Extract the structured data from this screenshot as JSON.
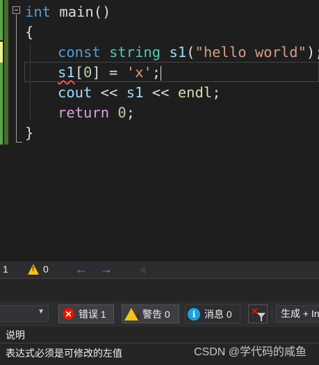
{
  "editor": {
    "lines": [
      {
        "t1": "int",
        "t2": " main()"
      },
      {
        "t1": "{"
      },
      {
        "t1": "const",
        "t2": "string",
        "t3": "s1",
        "t4": "(",
        "t5": "\"hello world\"",
        "t6": ");"
      },
      {
        "t1": "s1",
        "t2": "[",
        "t3": "0",
        "t4": "] = ",
        "t5": "'x'",
        "t6": ";"
      },
      {
        "t1": "cout",
        "t2": " << ",
        "t3": "s1",
        "t4": " << ",
        "t5": "endl",
        "t6": ";"
      },
      {
        "t1": "return",
        "t2": " ",
        "t3": "0",
        "t4": ";"
      },
      {
        "t1": "}"
      }
    ]
  },
  "nav": {
    "line_number": "1",
    "warning_count": "0"
  },
  "toolbar": {
    "errors_label": "错误 1",
    "warnings_label": "警告 0",
    "messages_label": "消息 0",
    "build_label": "生成 + In"
  },
  "error_list": {
    "column_header": "说明",
    "rows": [
      {
        "description": "表达式必须是可修改的左值"
      }
    ]
  },
  "watermark": "CSDN @学代码的咸鱼",
  "colors": {
    "background": "#1e1e1e",
    "keyword": "#569cd6",
    "type": "#4ec9b0",
    "string": "#d69d85",
    "number": "#b5cea8",
    "control": "#d8a0df",
    "error": "#e51400",
    "warning": "#f3c317",
    "info": "#1ba1e2"
  }
}
